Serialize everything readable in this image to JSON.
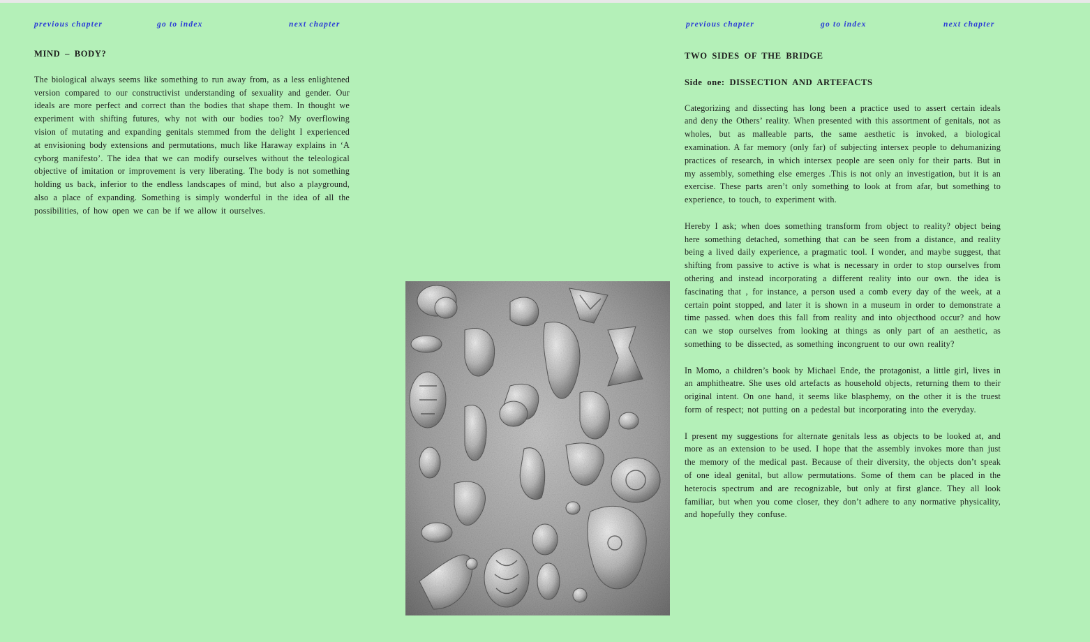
{
  "left": {
    "nav": {
      "previous": "previous chapter",
      "index": "go to index",
      "next": "next chapter"
    },
    "title": "MIND – BODY?",
    "paragraphs": [
      "The biological always seems like something to run away from, as a less enlightened version compared to our constructivist understanding of sexuality and gender. Our ideals are more perfect and correct than the bodies that shape them. In thought we experiment with shifting futures, why not with our bodies too? My overflowing vision of mutating and expanding genitals stemmed from the delight I experienced at envisioning body extensions and permutations, much like Haraway explains in ‘A cyborg manifesto’. The idea that we can modify ourselves without the teleological objective of imitation or improvement is very liberating. The body is not something holding us back, inferior to the endless landscapes of mind, but also a playground, also a place of expanding. Something is simply wonderful in the idea of all the possibilities, of how open we can be if we allow it ourselves."
    ]
  },
  "right": {
    "nav": {
      "previous": "previous chapter",
      "index": "go to index",
      "next": "next chapter"
    },
    "title": "TWO SIDES OF THE BRIDGE",
    "subtitle": "Side one: DISSECTION AND ARTEFACTS",
    "paragraphs": [
      "Categorizing and dissecting has long been a practice used to assert certain ideals and deny the Others’ reality. When presented with this assortment of genitals, not as wholes, but as malleable parts, the same aesthetic is invoked, a biological examination. A far memory (only far) of subjecting intersex people to dehumanizing practices of research, in which intersex people are seen only for their parts. But in my assembly, something else emerges .This is not only an investigation, but it is an exercise. These parts aren’t only something to look at from afar, but something to experience, to touch, to experiment with.",
      "Hereby I ask; when does something transform from object to reality? object being here something detached, something that can be seen from a distance, and reality being a lived daily experience, a pragmatic tool. I wonder, and maybe suggest, that shifting from passive to active is what is necessary in order to stop ourselves from othering and instead incorporating a different reality into our own. the idea is fascinating that , for instance, a person used a comb every day of the week, at a certain point stopped, and later it is shown in a museum in order to demonstrate a time passed. when does this fall from reality and into objecthood occur? and how can we stop ourselves from looking at things as only part of an aesthetic, as something to be dissected, as something incongruent to our own reality?",
      "In Momo, a children’s book by Michael Ende, the protagonist, a little girl, lives in an amphitheatre. She uses old artefacts as household objects, returning them to their original intent. On one hand, it seems like blasphemy, on the other it is the truest form of respect; not putting on a pedestal but incorporating into the everyday.",
      "I present my suggestions for alternate genitals less as objects to be looked at, and more as an extension to be used. I hope that the assembly invokes more than just the memory of the medical past. Because of their diversity, the objects don’t speak of one ideal genital, but allow permutations. Some of them can be placed in the heterocis spectrum and are recognizable, but only at first glance. They all look familiar, but when you come closer, they don’t adhere to any normative physicality, and hopefully they confuse."
    ]
  },
  "colors": {
    "background": "#b4f0b8",
    "link": "#2a3bd6",
    "text": "#1e1e1e"
  }
}
